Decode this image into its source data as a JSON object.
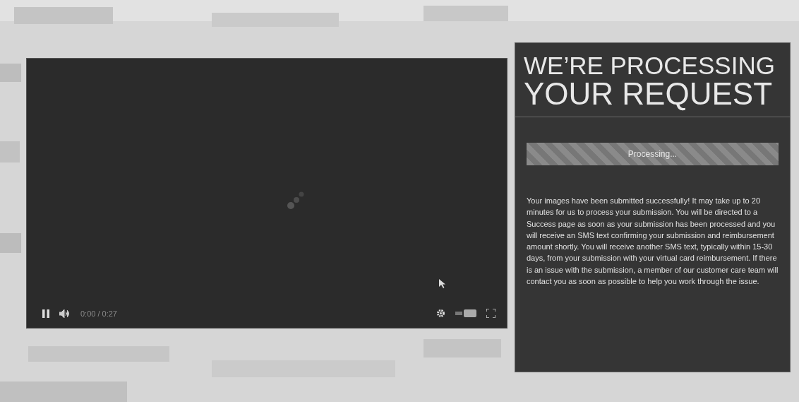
{
  "video": {
    "playing": true,
    "time": "0:00 / 0:27",
    "loading": true
  },
  "panel": {
    "title_line_1": "WE’RE PROCESSING",
    "title_line_2": "YOUR REQUEST",
    "progress": {
      "label": "Processing...",
      "level": 1
    },
    "message": "Your images have been submitted successfully! It may take up to 20 minutes for us to process your submission. You will be directed to a Success page as soon as your submission has been processed and you will receive an SMS text confirming your submission and reimbursement amount shortly. You will receive another SMS text, typically within 15-30 days, from your submission with your virtual card reimbursement. If there is an issue with the submission, a member of our customer care team will contact you as soon as possible to help you work through the issue."
  }
}
